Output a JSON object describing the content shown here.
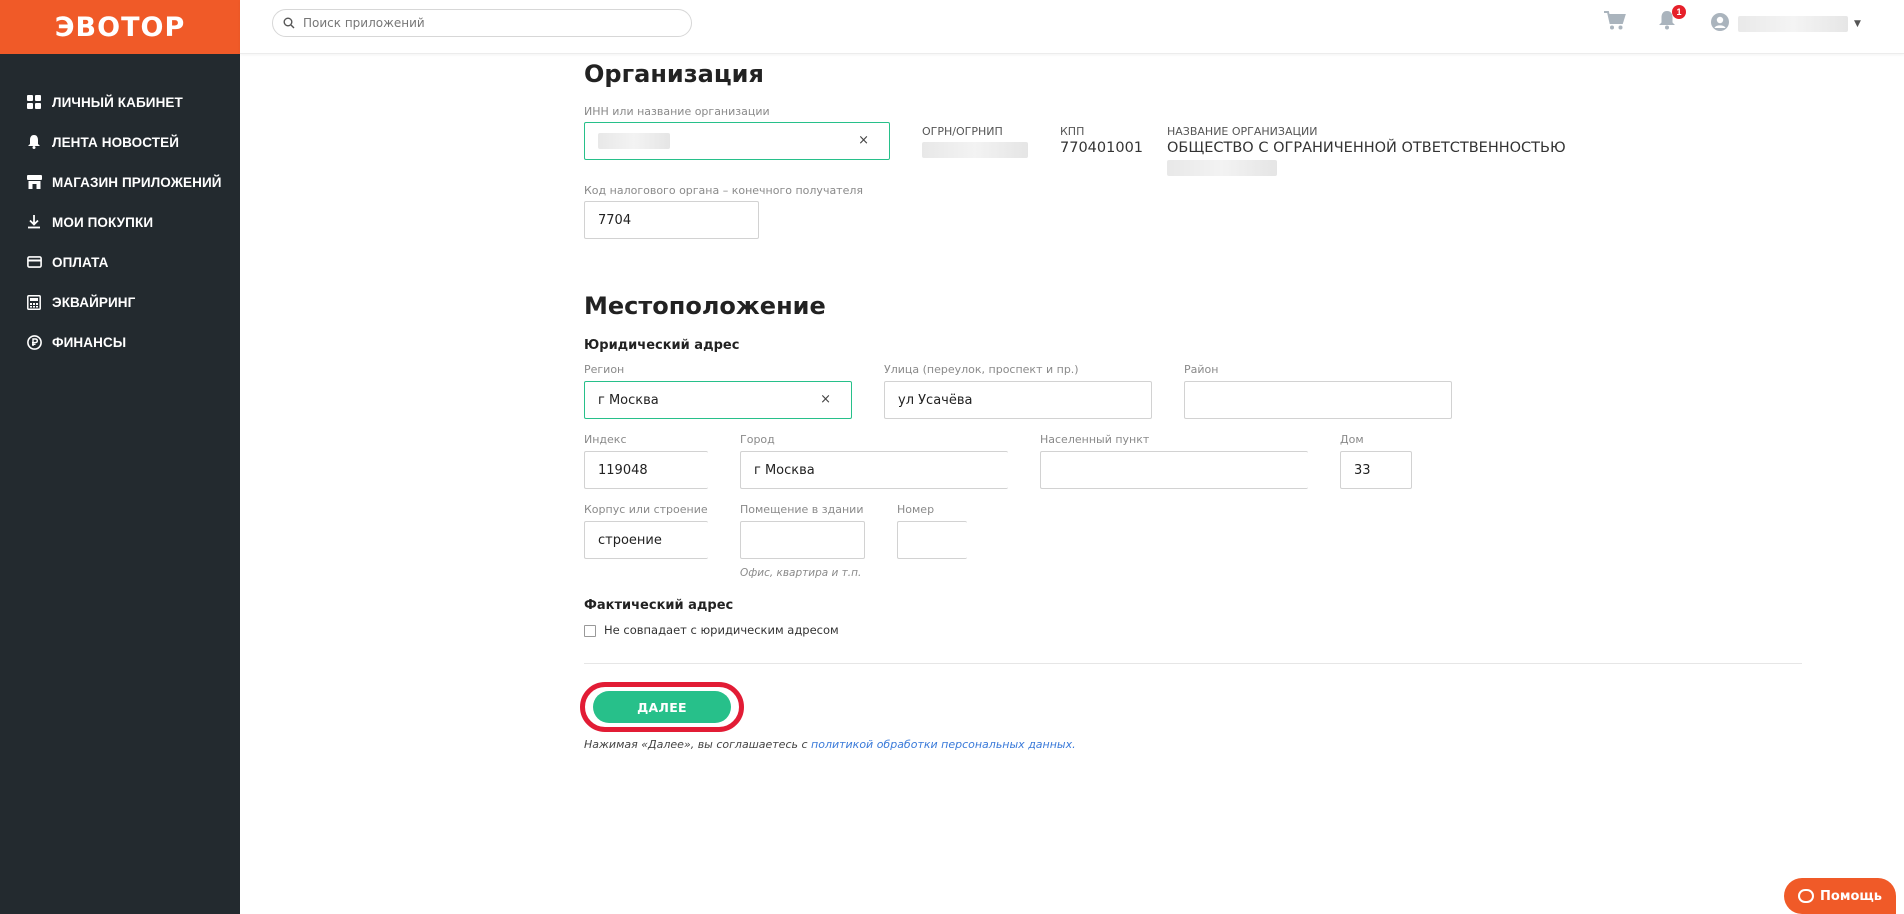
{
  "brand": {
    "logo": "ЭВОТОР",
    "color": "#f05a28",
    "accent": "#27c08a",
    "sidebar_bg": "#232a2f"
  },
  "sidebar": {
    "items": [
      {
        "label": "ЛИЧНЫЙ КАБИНЕТ",
        "icon": "dashboard-icon"
      },
      {
        "label": "ЛЕНТА НОВОСТЕЙ",
        "icon": "bell-icon"
      },
      {
        "label": "МАГАЗИН ПРИЛОЖЕНИЙ",
        "icon": "store-icon"
      },
      {
        "label": "МОИ ПОКУПКИ",
        "icon": "download-icon"
      },
      {
        "label": "ОПЛАТА",
        "icon": "card-icon"
      },
      {
        "label": "ЭКВАЙРИНГ",
        "icon": "terminal-icon"
      },
      {
        "label": "ФИНАНСЫ",
        "icon": "ruble-icon"
      }
    ]
  },
  "header": {
    "search_placeholder": "Поиск приложений",
    "notifications_count": "1"
  },
  "organization": {
    "title": "Организация",
    "inn_label": "ИНН или название организации",
    "clear_symbol": "×",
    "ogrn_header": "ОГРН/ОГРНИП",
    "kpp_header": "КПП",
    "kpp_value": "770401001",
    "name_header": "НАЗВАНИЕ ОРГАНИЗАЦИИ",
    "name_value": "ОБЩЕСТВО С ОГРАНИЧЕННОЙ ОТВЕТСТВЕННОСТЬЮ",
    "tax_label": "Код налогового органа – конечного получателя",
    "tax_value": "7704"
  },
  "location": {
    "title": "Местоположение",
    "legal_title": "Юридический адрес",
    "region_label": "Регион",
    "region_value": "г Москва",
    "street_label": "Улица (переулок, проспект и пр.)",
    "street_value": "ул Усачёва",
    "district_label": "Район",
    "district_value": "",
    "index_label": "Индекс",
    "index_value": "119048",
    "city_label": "Город",
    "city_value": "г Москва",
    "locality_label": "Населенный пункт",
    "locality_value": "",
    "house_label": "Дом",
    "house_value": "33",
    "building_label": "Корпус или строение",
    "building_value": "строение",
    "room_label": "Помещение в здании",
    "room_value": "",
    "room_hint": "Офис, квартира и т.п.",
    "number_label": "Номер",
    "number_value": "",
    "actual_title": "Фактический адрес",
    "actual_checkbox": "Не совпадает с юридическим адресом"
  },
  "actions": {
    "next_label": "ДАЛЕЕ",
    "agreement_text": "Нажимая «Далее», вы соглашаетесь с ",
    "agreement_link": "политикой обработки персональных данных."
  },
  "help": {
    "label": "Помощь"
  }
}
